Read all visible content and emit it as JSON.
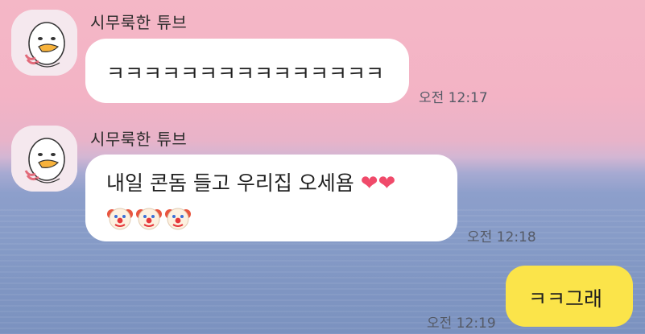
{
  "chat": {
    "messages": [
      {
        "sender": "시무룩한 튜브",
        "text": "ㅋㅋㅋㅋㅋㅋㅋㅋㅋㅋㅋㅋㅋㅋㅋ",
        "time": "오전 12:17"
      },
      {
        "sender": "시무룩한 튜브",
        "text": "내일 콘돔 들고 우리집 오세욤",
        "hearts": "❤❤",
        "emojis": [
          "clown-face-icon",
          "clown-face-icon",
          "clown-face-icon"
        ],
        "time": "오전 12:18"
      },
      {
        "text": "ㅋㅋ그래",
        "time": "오전 12:19"
      }
    ]
  },
  "colors": {
    "my_bubble": "#fbe44a",
    "their_bubble": "#ffffff",
    "heart": "#f04a6a"
  }
}
